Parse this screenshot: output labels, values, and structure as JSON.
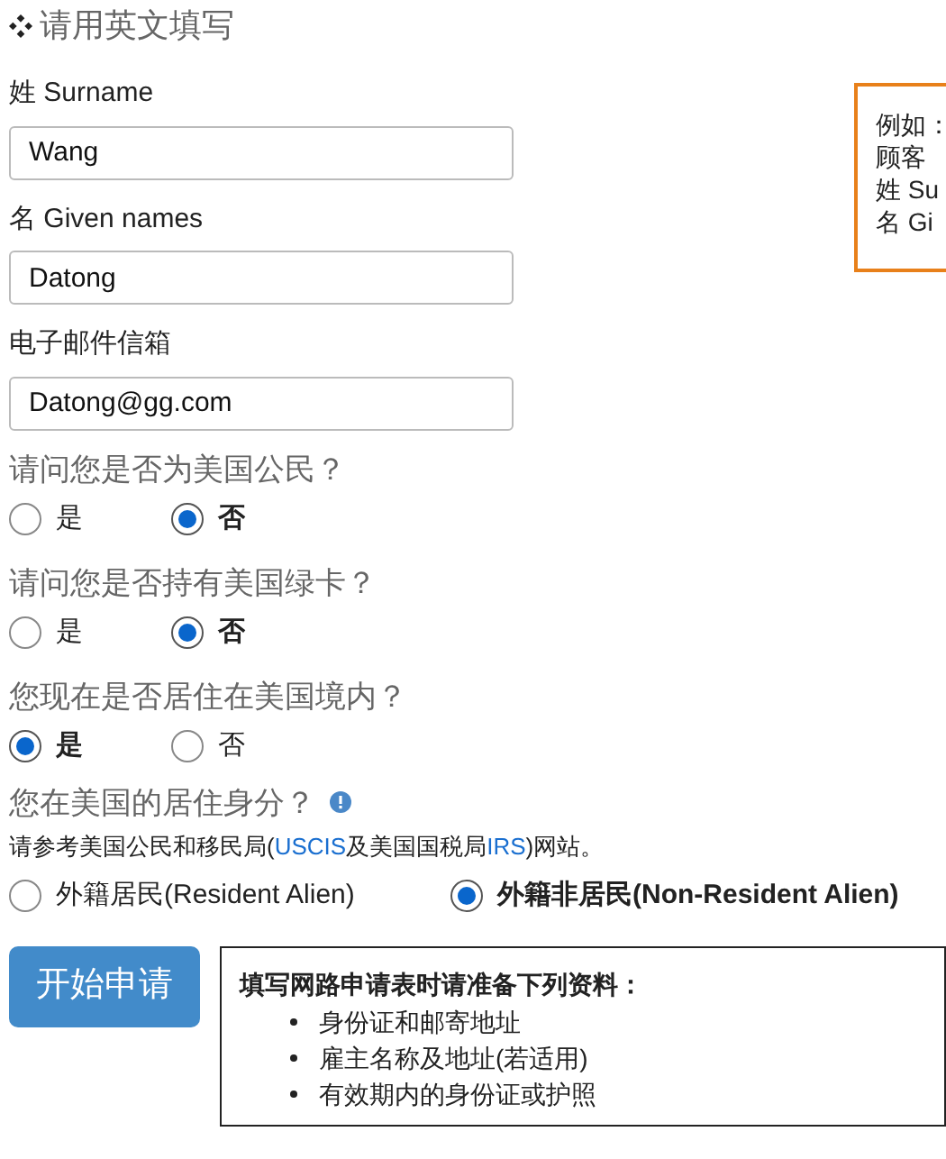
{
  "heading": {
    "text": "请用英文填写"
  },
  "fields": [
    {
      "label": "姓 Surname",
      "value": "Wang"
    },
    {
      "label": "名 Given names",
      "value": "Datong"
    },
    {
      "label": "电子邮件信箱",
      "value": "Datong@gg.com"
    }
  ],
  "example_box": {
    "lines": [
      "例如：",
      "顾客",
      "姓 Su",
      "名 Gi"
    ]
  },
  "questions": [
    {
      "text": "请问您是否为美国公民？",
      "options": [
        {
          "label": "是",
          "selected": false
        },
        {
          "label": "否",
          "selected": true
        }
      ]
    },
    {
      "text": "请问您是否持有美国绿卡？",
      "options": [
        {
          "label": "是",
          "selected": false
        },
        {
          "label": "否",
          "selected": true
        }
      ]
    },
    {
      "text": "您现在是否居住在美国境内？",
      "options": [
        {
          "label": "是",
          "selected": true
        },
        {
          "label": "否",
          "selected": false
        }
      ]
    }
  ],
  "residency": {
    "text": "您在美国的居住身分？",
    "note_parts": [
      {
        "kind": "text",
        "text": "请参考美国公民和移民局("
      },
      {
        "kind": "link",
        "text": "USCIS"
      },
      {
        "kind": "text",
        "text": "及美国国税局"
      },
      {
        "kind": "link",
        "text": "IRS"
      },
      {
        "kind": "text",
        "text": ")网站。"
      }
    ],
    "options": [
      {
        "label": "外籍居民(Resident Alien)",
        "selected": false
      },
      {
        "label": "外籍非居民(Non-Resident Alien)",
        "selected": true
      }
    ]
  },
  "start_button": {
    "label": "开始申请"
  },
  "checklist": {
    "title": "填写网路申请表时请准备下列资料：",
    "items": [
      "身份证和邮寄地址",
      "雇主名称及地址(若适用)",
      "有效期内的身份证或护照"
    ]
  }
}
